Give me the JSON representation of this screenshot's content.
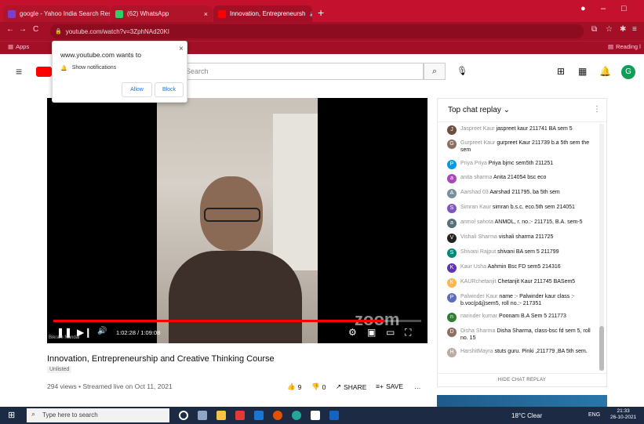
{
  "browser": {
    "tabs": [
      {
        "label": "google - Yahoo India Search Res",
        "close": "×",
        "color": "#7b3fd0"
      },
      {
        "label": "(62) WhatsApp",
        "close": "×",
        "color": "#25d366"
      },
      {
        "label": "Innovation, Entrepreneursh",
        "close": "×",
        "audio": "🔊",
        "color": "#ff0000"
      }
    ],
    "new_tab": "+",
    "url": "youtube.com/watch?v=3ZphNAd20KI",
    "bookmarks_apps": "Apps",
    "reading_list": "Reading l",
    "window_controls": [
      "–",
      "□"
    ]
  },
  "notification": {
    "site": "www.youtube.com wants to",
    "item": "Show notifications",
    "allow": "Allow",
    "block": "Block",
    "close": "×"
  },
  "masthead": {
    "search_placeholder": "Search",
    "avatar_letter": "G"
  },
  "video": {
    "time": "1:02:28 / 1:09:08",
    "watermark": "zoom",
    "name_tag": "Bikram Nandal",
    "progress": 0.9
  },
  "info": {
    "title": "Innovation, Entrepreneurship and Creative Thinking Course",
    "badge": "Unlisted",
    "stats": "294 views • Streamed live on Oct 11, 2021",
    "likes": "9",
    "dislikes": "0",
    "share": "SHARE",
    "save": "SAVE",
    "more": "…"
  },
  "chat": {
    "header": "Top chat replay",
    "hide": "HIDE CHAT REPLAY",
    "messages": [
      {
        "author": "Jaspreet Kaur",
        "text": "jaspreet kaur 211741 BA sem 5",
        "color": "#6d4c41",
        "initial": "J"
      },
      {
        "author": "Gurpreet Kaur",
        "text": "gurpreet Kaur 211739 b.a 5th sem the sem",
        "color": "#8d6e63",
        "initial": "G"
      },
      {
        "author": "Priya Priya",
        "text": "Priya bjmc sem5th 211251",
        "color": "#039be5",
        "initial": "P"
      },
      {
        "author": "anita sharma",
        "text": "Anita 214054 bsc eco",
        "color": "#ab47bc",
        "initial": "a"
      },
      {
        "author": "Aarshad 03",
        "text": "Aarshad 211795. ba 5th sem",
        "color": "#78909c",
        "initial": "A"
      },
      {
        "author": "Simran Kaur",
        "text": "simran b.s.c. eco.5th sem 214051",
        "color": "#7e57c2",
        "initial": "S"
      },
      {
        "author": "anmol sahota",
        "text": "ANMOL, r. no.:- 211715, B.A. sem-5",
        "color": "#546e7a",
        "initial": "a"
      },
      {
        "author": "Vishali Sharma",
        "text": "vishali sharma 211725",
        "color": "#212121",
        "initial": "V"
      },
      {
        "author": "Shivani Rajput",
        "text": "shivani BA sem 5 211799",
        "color": "#00897b",
        "initial": "S"
      },
      {
        "author": "Kaur Usha",
        "text": "Aahmin Bsc FD sem5 214316",
        "color": "#5e35b1",
        "initial": "K"
      },
      {
        "author": "KAURchetanjit",
        "text": "Chetanjit Kaur 211745 BASem5",
        "color": "#ffb74d",
        "initial": "K"
      },
      {
        "author": "Palwinder Kaur",
        "text": "name :- Palwinder kaur class :- b.voc(p&j)sem5, roll no.:- 217351",
        "color": "#5c6bc0",
        "initial": "P"
      },
      {
        "author": "narinder kumar",
        "text": "Poonam B.A Sem 5 211773",
        "color": "#2e7d32",
        "initial": "n"
      },
      {
        "author": "Disha Sharma",
        "text": "Disha Sharma, class-bsc fd sem 5, roll no. 15",
        "color": "#8d6e63",
        "initial": "D"
      },
      {
        "author": "HarshitMayra",
        "text": "stuts guru. Pinki ,211779 ,BA 5th sem.",
        "color": "#bcaaa4",
        "initial": "H"
      }
    ]
  },
  "taskbar": {
    "search": "Type here to search",
    "weather": "18°C Clear",
    "lang": "ENG",
    "time": "21:33",
    "date": "26-10-2021"
  }
}
